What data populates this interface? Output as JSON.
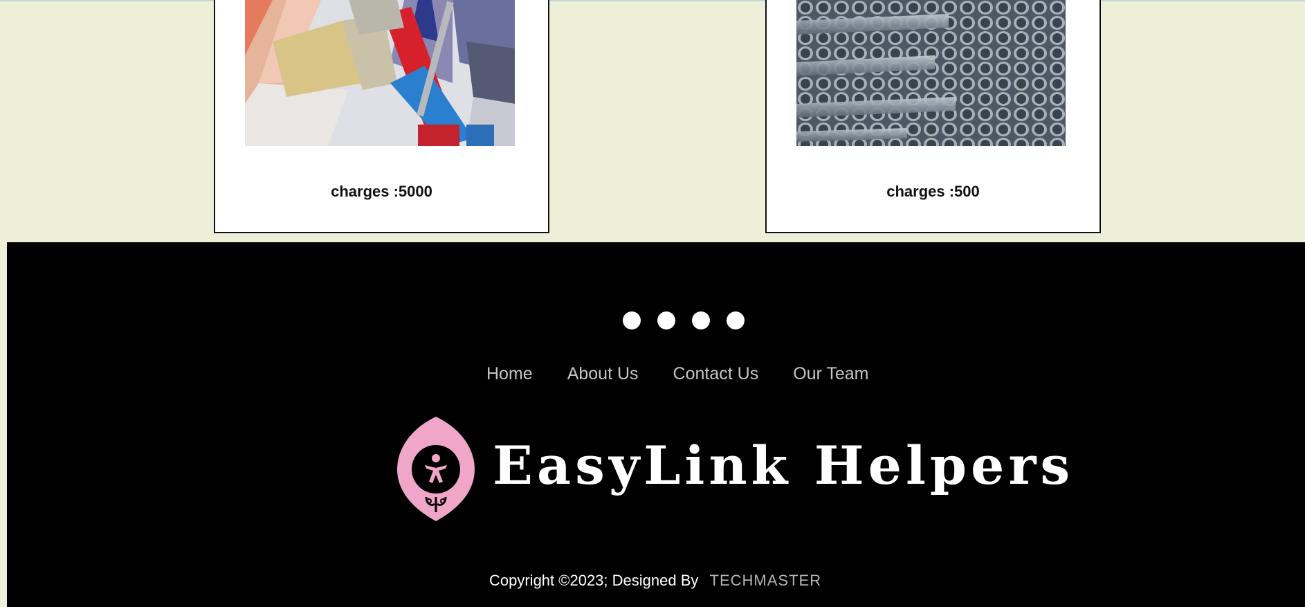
{
  "services": [
    {
      "charges": "charges :5000",
      "image": "paint-brushes-and-color-swatches"
    },
    {
      "charges": "charges :500",
      "image": "stacked-steel-pipes"
    }
  ],
  "footer": {
    "social_icons": [
      "social-icon-1",
      "social-icon-2",
      "social-icon-3",
      "social-icon-4"
    ],
    "nav": {
      "home": "Home",
      "about": "About Us",
      "contact": "Contact Us",
      "team": "Our Team"
    },
    "brand": {
      "name": "EasyLink Helpers",
      "logo_color": "#f0a6c8"
    },
    "copyright": "Copyright ©2023; Designed By",
    "designer": "TECHMASTER"
  },
  "colors": {
    "page_background": "#eeefd8",
    "footer_background": "#000000",
    "nav_link": "#c6c6c6"
  }
}
